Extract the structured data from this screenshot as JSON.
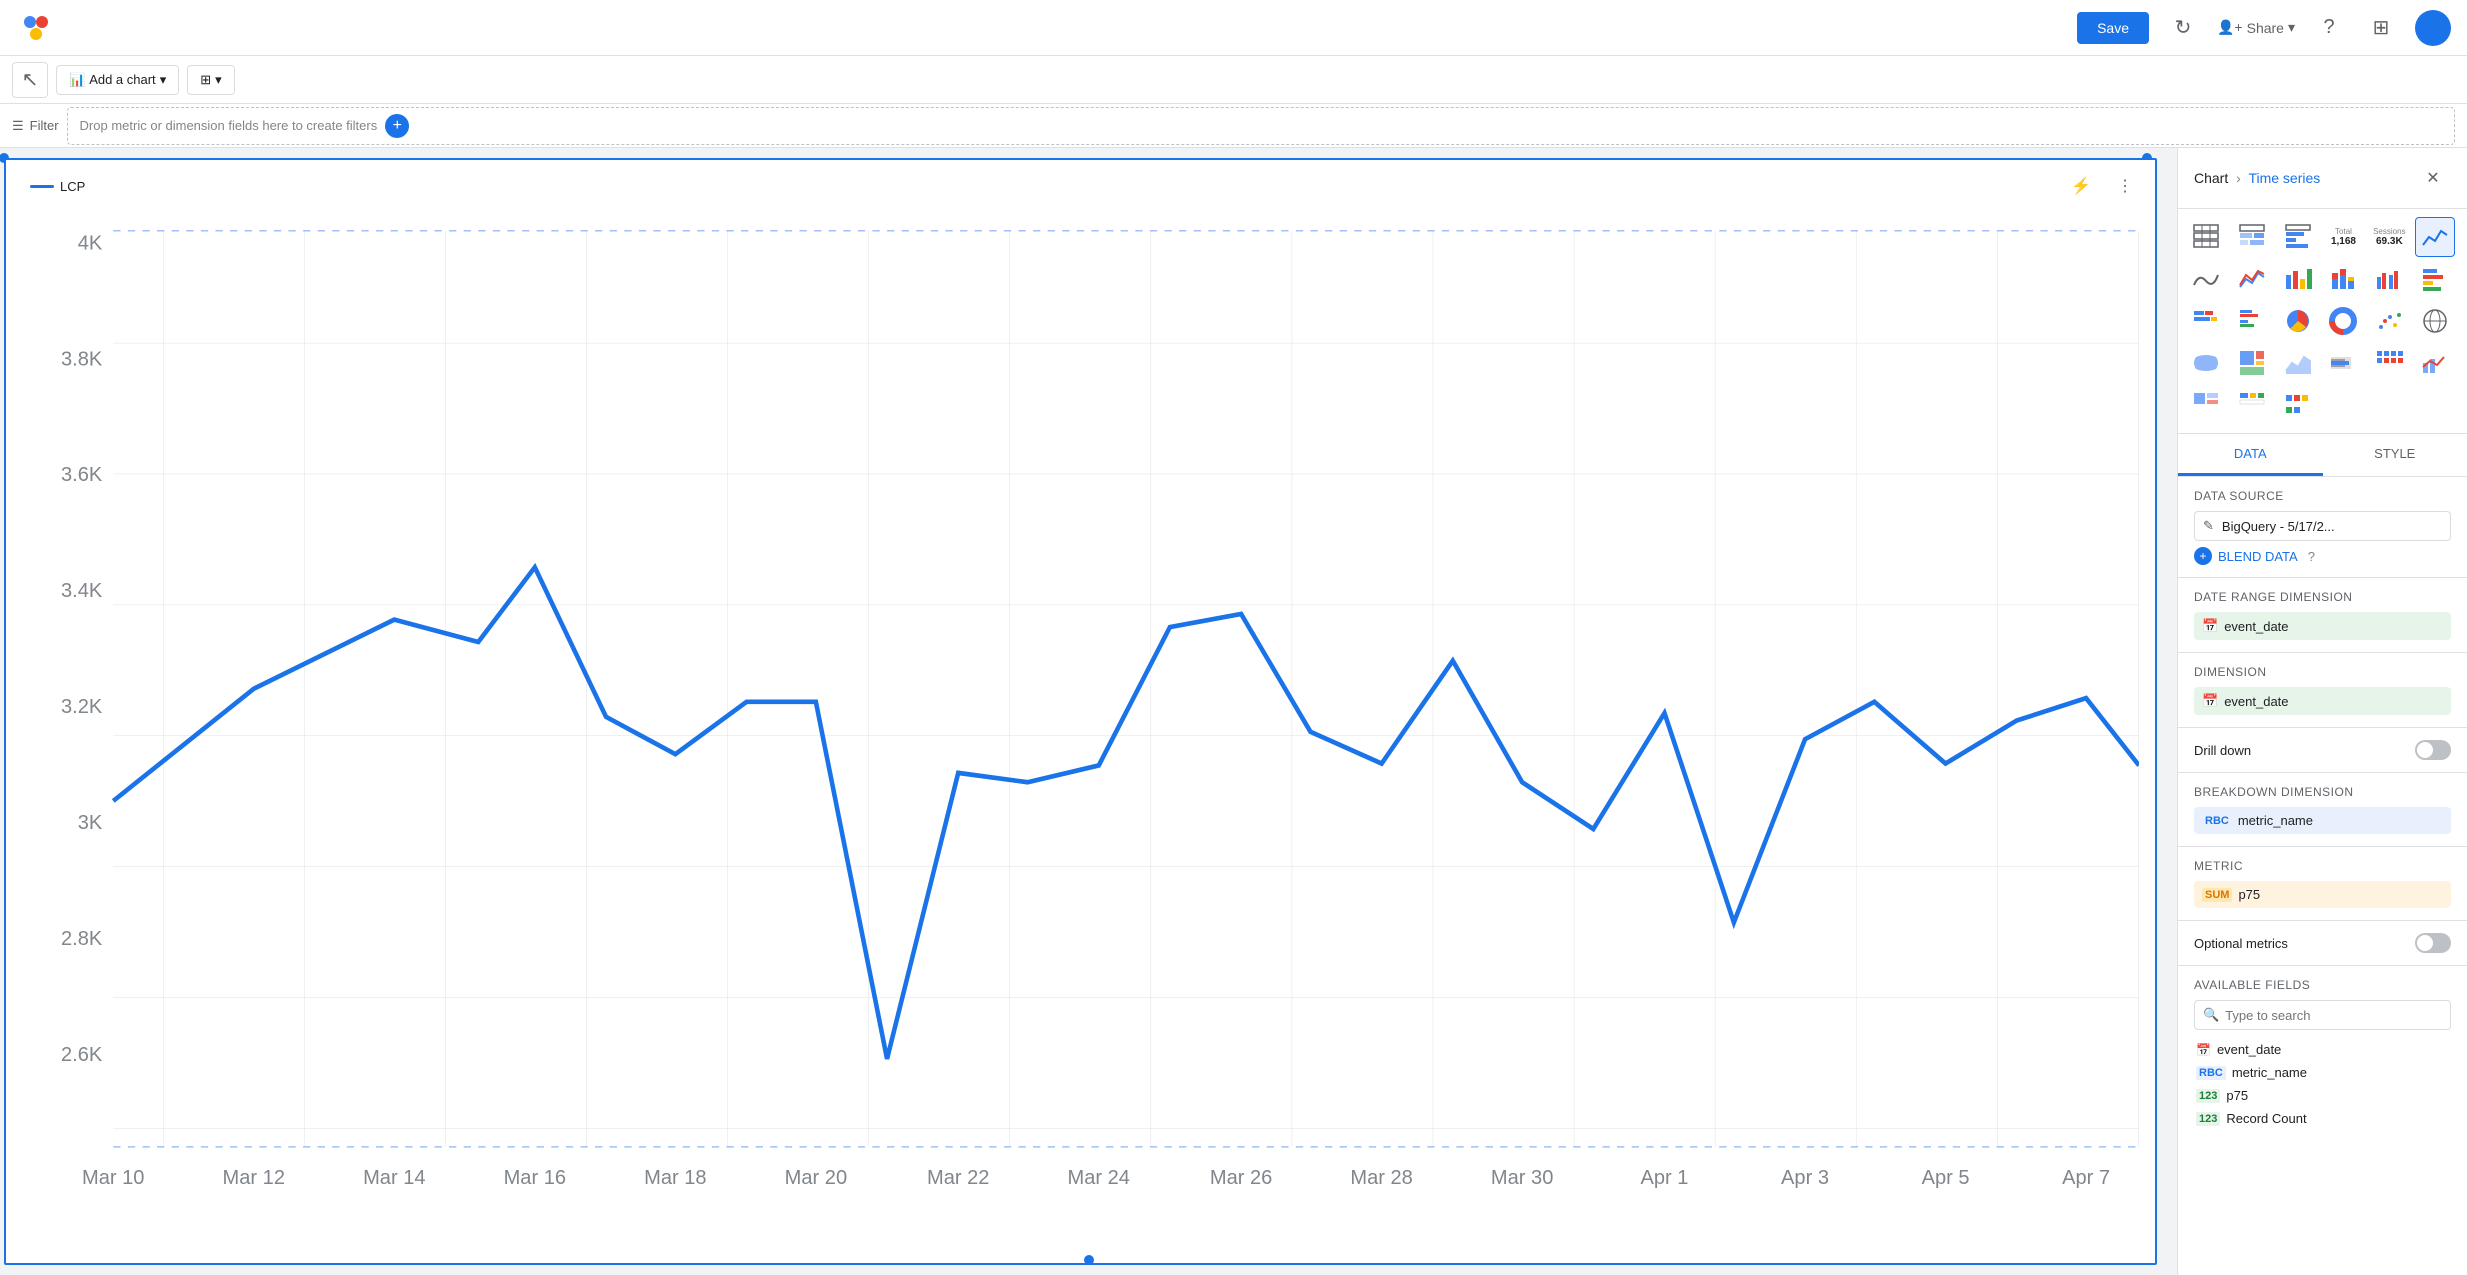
{
  "navbar": {
    "save_label": "Save",
    "share_label": "Share",
    "logo_icon": "dots-logo"
  },
  "toolbar": {
    "cursor_icon": "cursor-icon",
    "add_chart_label": "Add a chart",
    "add_chart_icon": "add-chart-icon",
    "controls_icon": "controls-icon"
  },
  "filter_bar": {
    "filter_label": "Filter",
    "drop_text": "Drop metric or dimension fields here to create filters",
    "add_icon": "plus-icon"
  },
  "panel": {
    "breadcrumb_chart": "Chart",
    "breadcrumb_sep": "›",
    "breadcrumb_current": "Time series",
    "tabs": [
      "DATA",
      "STYLE"
    ],
    "active_tab": "DATA",
    "data_source_label": "Data source",
    "data_source_name": "BigQuery - 5/17/2...",
    "blend_data_label": "BLEND DATA",
    "date_range_label": "Date Range Dimension",
    "date_range_field": "event_date",
    "dimension_label": "Dimension",
    "dimension_field": "event_date",
    "drill_down_label": "Drill down",
    "breakdown_label": "Breakdown Dimension",
    "breakdown_field": "metric_name",
    "metric_label": "Metric",
    "metric_field": "p75",
    "metric_prefix": "SUM",
    "optional_metrics_label": "Optional metrics",
    "available_fields_title": "Available Fields",
    "search_placeholder": "Type to search",
    "fields": [
      {
        "name": "event_date",
        "type": "calendar",
        "type_label": ""
      },
      {
        "name": "metric_name",
        "type": "rbc",
        "type_label": "RBC"
      },
      {
        "name": "p75",
        "type": "123",
        "type_label": "123"
      },
      {
        "name": "Record Count",
        "type": "123",
        "type_label": "123"
      }
    ]
  },
  "chart": {
    "legend_label": "LCP",
    "y_axis": [
      "4K",
      "3.8K",
      "3.6K",
      "3.4K",
      "3.2K",
      "3K",
      "2.8K",
      "2.6K"
    ],
    "x_axis": [
      "Mar 10",
      "Mar 12",
      "Mar 14",
      "Mar 16",
      "Mar 18",
      "Mar 20",
      "Mar 22",
      "Mar 24",
      "Mar 26",
      "Mar 28",
      "Mar 30",
      "Apr 1",
      "Apr 3",
      "Apr 5",
      "Apr 7"
    ],
    "color": "#1a73e8"
  },
  "chart_types": [
    {
      "icon": "⊞",
      "label": "table"
    },
    {
      "icon": "⊟",
      "label": "table-heatmap"
    },
    {
      "icon": "⊠",
      "label": "table-bar"
    },
    {
      "icon": "📊",
      "label": "scorecard-total",
      "badge": "1,168"
    },
    {
      "icon": "📈",
      "label": "scorecard-sessions",
      "badge": "69.3K"
    },
    {
      "icon": "📉",
      "label": "time-series",
      "selected": true
    },
    {
      "icon": "〰",
      "label": "smooth-line"
    },
    {
      "icon": "📈",
      "label": "line-chart"
    },
    {
      "icon": "▐",
      "label": "bar-chart"
    },
    {
      "icon": "🌈",
      "label": "stacked-bar"
    },
    {
      "icon": "▐▌",
      "label": "grouped-bar"
    },
    {
      "icon": "☰",
      "label": "horizontal-bar"
    },
    {
      "icon": "≡",
      "label": "stacked-horizontal"
    },
    {
      "icon": "≣",
      "label": "grouped-horizontal"
    },
    {
      "icon": "◉",
      "label": "pie"
    },
    {
      "icon": "◎",
      "label": "donut"
    },
    {
      "icon": "⠿",
      "label": "scatter"
    },
    {
      "icon": "🌍",
      "label": "geo-map"
    },
    {
      "icon": "🗺",
      "label": "filled-map"
    },
    {
      "icon": "🏔",
      "label": "treemap"
    },
    {
      "icon": "📊",
      "label": "pivot"
    },
    {
      "icon": "〰",
      "label": "area-chart"
    },
    {
      "icon": "📊",
      "label": "bullet"
    },
    {
      "icon": "⋯",
      "label": "waffle"
    },
    {
      "icon": "📊",
      "label": "combo"
    }
  ]
}
